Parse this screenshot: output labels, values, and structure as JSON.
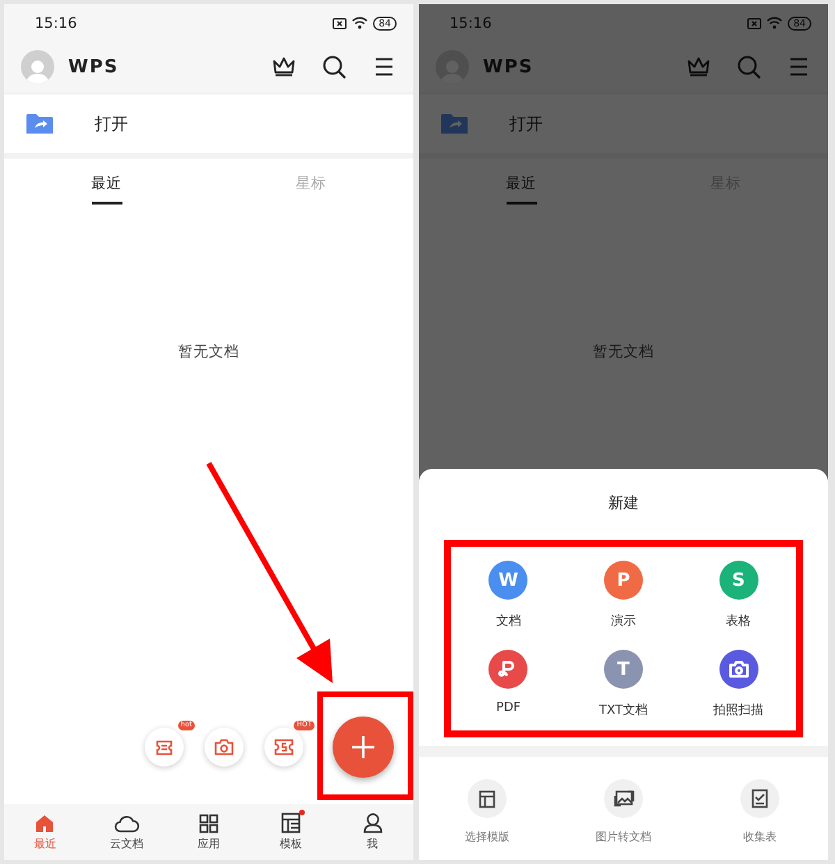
{
  "screens": [
    {
      "status_bar": {
        "time": "15:16",
        "battery": "84"
      },
      "header": {
        "logo": "WPS"
      },
      "open_row": {
        "label": "打开"
      },
      "tabs": [
        {
          "label": "最近",
          "selected": true
        },
        {
          "label": "星标",
          "selected": false
        }
      ],
      "empty_text": "暂无文档",
      "quick_actions": [
        {
          "kind": "ticket",
          "badge": "hot"
        },
        {
          "kind": "camera"
        },
        {
          "kind": "coupon",
          "badge": "HOT"
        }
      ],
      "fab": {
        "highlighted": true
      },
      "bottom_nav": [
        {
          "label": "最近",
          "selected": true,
          "dot": false
        },
        {
          "label": "云文档",
          "selected": false,
          "dot": false
        },
        {
          "label": "应用",
          "selected": false,
          "dot": false
        },
        {
          "label": "模板",
          "selected": false,
          "dot": true
        },
        {
          "label": "我",
          "selected": false,
          "dot": false
        }
      ],
      "annotation_arrow": true
    },
    {
      "status_bar": {
        "time": "15:16",
        "battery": "84"
      },
      "header": {
        "logo": "WPS"
      },
      "open_row": {
        "label": "打开"
      },
      "tabs": [
        {
          "label": "最近",
          "selected": true
        },
        {
          "label": "星标",
          "selected": false
        }
      ],
      "empty_text": "暂无文档",
      "dimmed": true,
      "sheet": {
        "title": "新建",
        "highlighted": true,
        "items": [
          {
            "label": "文档",
            "kind": "letter",
            "glyph": "W",
            "color": "#4a8ef0"
          },
          {
            "label": "演示",
            "kind": "letter",
            "glyph": "P",
            "color": "#f06b45"
          },
          {
            "label": "表格",
            "kind": "letter",
            "glyph": "S",
            "color": "#1bb37a"
          },
          {
            "label": "PDF",
            "kind": "pdf",
            "color": "#e84a4a"
          },
          {
            "label": "TXT文档",
            "kind": "letter",
            "glyph": "T",
            "color": "#8a93b0"
          },
          {
            "label": "拍照扫描",
            "kind": "camera",
            "color": "#5a5ae0"
          }
        ],
        "extras": [
          {
            "label": "选择模版",
            "kind": "template"
          },
          {
            "label": "图片转文档",
            "kind": "image"
          },
          {
            "label": "收集表",
            "kind": "form"
          }
        ]
      }
    }
  ]
}
